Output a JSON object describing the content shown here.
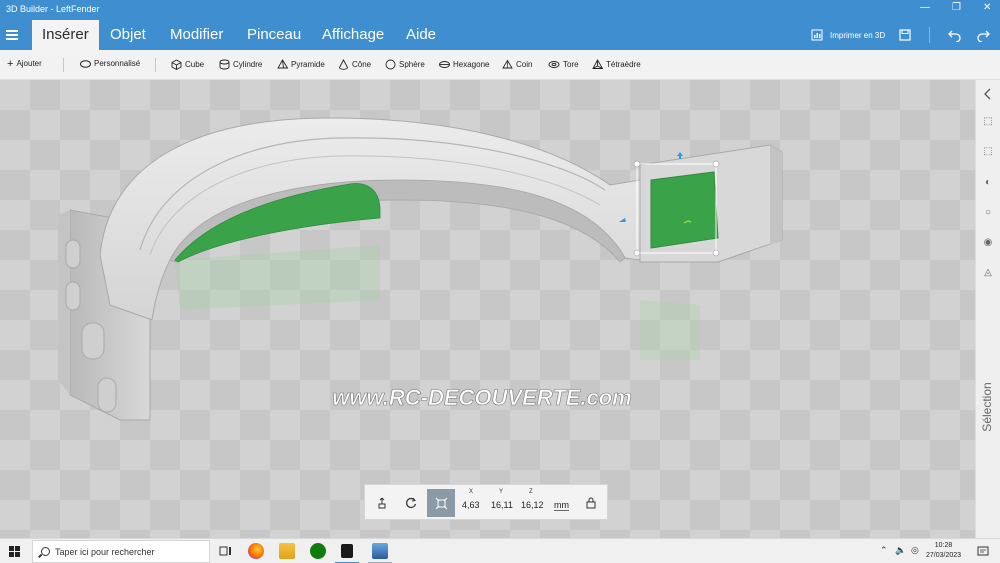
{
  "app": {
    "title": "3D Builder - LeftFender"
  },
  "tabs": [
    {
      "label": "Insérer",
      "active": true
    },
    {
      "label": "Objet"
    },
    {
      "label": "Modifier"
    },
    {
      "label": "Pinceau"
    },
    {
      "label": "Affichage"
    },
    {
      "label": "Aide"
    }
  ],
  "header_tools": {
    "print3d_label": "Imprimer en 3D"
  },
  "toolbar": {
    "add_label": "Ajouter",
    "custom_label": "Personnalisé",
    "shapes": [
      "Cube",
      "Cylindre",
      "Pyramide",
      "Cône",
      "Sphère",
      "Hexagone",
      "Coin",
      "Tore",
      "Tétraèdre"
    ]
  },
  "watermark": "www.RC-DECOUVERTE.com",
  "sidebar": {
    "label": "Sélection"
  },
  "transform": {
    "x_label": "X",
    "y_label": "Y",
    "z_label": "Z",
    "x_value": "4,63",
    "y_value": "16,11",
    "z_value": "16,12",
    "unit": "mm"
  },
  "taskbar": {
    "search_placeholder": "Taper ici pour rechercher",
    "time": "10:28",
    "date": "27/03/2023"
  },
  "colors": {
    "accent": "#3f8fd0",
    "selection_green": "#3aa34a",
    "gizmo_blue": "#2b9be6"
  }
}
